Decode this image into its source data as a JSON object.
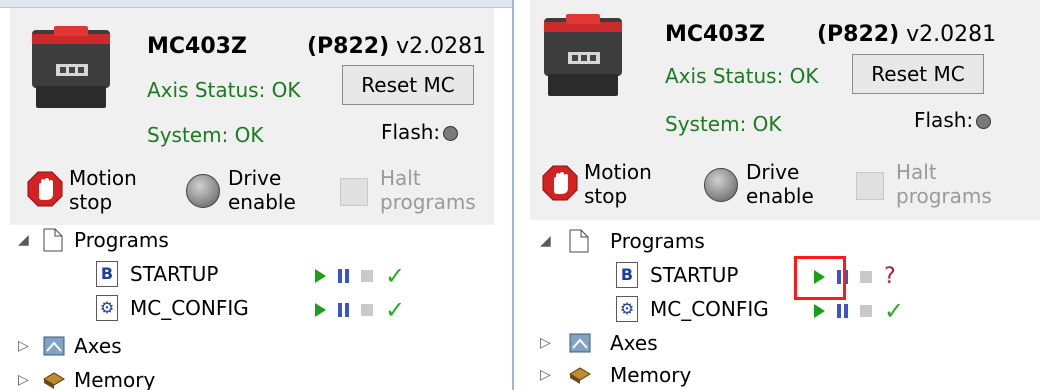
{
  "panels": [
    {
      "model": "MC403Z",
      "pcode": "(P822)",
      "version": "v2.0281",
      "axis_status": "Axis Status: OK",
      "reset_label": "Reset MC",
      "system_status": "System: OK",
      "flash_label": "Flash:",
      "controls": {
        "motion_stop": [
          "Motion",
          "stop"
        ],
        "drive_enable": [
          "Drive",
          "enable"
        ],
        "halt_programs": [
          "Halt",
          "programs"
        ]
      },
      "tree": {
        "programs_label": "Programs",
        "programs": [
          {
            "badge": "B",
            "name": "STARTUP",
            "status": "✓"
          },
          {
            "badge": "⚙",
            "name": "MC_CONFIG",
            "status": "✓"
          }
        ],
        "axes_label": "Axes",
        "memory_label": "Memory"
      }
    },
    {
      "model": "MC403Z",
      "pcode": "(P822)",
      "version": "v2.0281",
      "axis_status": "Axis Status: OK",
      "reset_label": "Reset MC",
      "system_status": "System: OK",
      "flash_label": "Flash:",
      "controls": {
        "motion_stop": [
          "Motion",
          "stop"
        ],
        "drive_enable": [
          "Drive",
          "enable"
        ],
        "halt_programs": [
          "Halt",
          "programs"
        ]
      },
      "tree": {
        "programs_label": "Programs",
        "programs": [
          {
            "badge": "B",
            "name": "STARTUP",
            "status": "?"
          },
          {
            "badge": "⚙",
            "name": "MC_CONFIG",
            "status": "✓"
          }
        ],
        "axes_label": "Axes",
        "memory_label": "Memory"
      }
    }
  ],
  "colors": {
    "status_ok": "#1d7a22",
    "play": "#18a018",
    "pause": "#3a55c8",
    "check": "#22b022",
    "question": "#b22020",
    "highlight": "#ff1a1a"
  },
  "icons": {
    "expanded": "expand-triangle-icon",
    "collapsed": "collapse-triangle-icon",
    "programs": "folder-page-icon",
    "axes": "axes-icon",
    "memory": "memory-chip-icon"
  }
}
